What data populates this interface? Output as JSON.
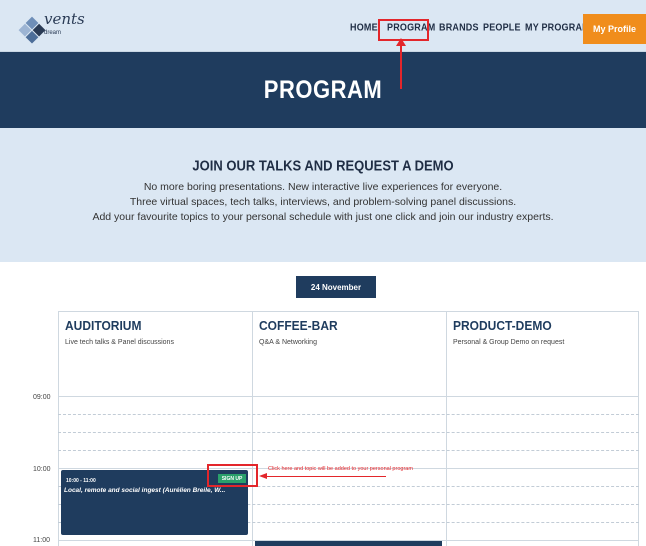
{
  "brand": {
    "logo_word": "vents",
    "logo_sub": "dream"
  },
  "nav": {
    "items": [
      "HOME",
      "PROGRAM",
      "BRANDS",
      "PEOPLE",
      "MY PROGRAM"
    ],
    "profile_label": "My Profile"
  },
  "banner": {
    "title": "PROGRAM"
  },
  "intro": {
    "heading": "JOIN OUR TALKS AND REQUEST A DEMO",
    "lines": [
      "No more boring presentations. New interactive live experiences for everyone.",
      "Three virtual spaces, tech talks, interviews, and problem-solving panel discussions.",
      "Add your favourite topics to your personal schedule with just one click and join our industry experts."
    ]
  },
  "date_tab": {
    "label": "24 November"
  },
  "schedule": {
    "columns": [
      {
        "title": "AUDITORIUM",
        "subtitle": "Live tech talks & Panel discussions"
      },
      {
        "title": "COFFEE-BAR",
        "subtitle": "Q&A & Networking"
      },
      {
        "title": "PRODUCT-DEMO",
        "subtitle": "Personal & Group Demo on request"
      }
    ],
    "times": [
      "09:00",
      "10:00",
      "11:00"
    ],
    "session": {
      "time": "10:00 - 11:00",
      "title": "Local, remote and social ingest (Aurélien Breile, W...",
      "signup_label": "SIGN UP"
    },
    "annotation": "Click here and topic will be added to your personal program"
  },
  "colors": {
    "header_bg": "#dbe7f3",
    "banner_bg": "#1f3c5e",
    "accent_orange": "#f08d1c",
    "signup_green": "#2aa06b",
    "annotation_red": "#e3262b"
  }
}
